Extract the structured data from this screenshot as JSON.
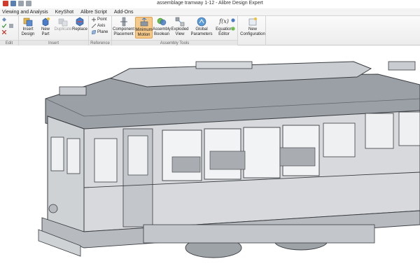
{
  "window": {
    "title": "assemblage tramway 1-12 - Alibre Design Expert"
  },
  "menu": {
    "tabs": [
      {
        "label": "Viewing and Analysis"
      },
      {
        "label": "KeyShot"
      },
      {
        "label": "Alibre Script"
      },
      {
        "label": "Add-Ons"
      }
    ]
  },
  "ribbon": {
    "groups": {
      "edit": "Edit",
      "insert": "Insert",
      "reference": "Reference",
      "assembly_tools": "Assembly Tools"
    },
    "buttons": {
      "insert_design": "Insert Design",
      "new_part": "New Part",
      "duplicate": "Duplicate",
      "replace": "Replace",
      "point": "Point",
      "axis": "Axis",
      "plane": "Plane",
      "component_placement": "Component Placement",
      "minimum_motion": "Minimum Motion",
      "assembly_boolean": "Assembly Boolean",
      "exploded_view": "Exploded View",
      "global_parameters": "Global Parameters",
      "equation_editor": "Equation Editor",
      "new_configuration": "New Configuration"
    },
    "icon_glyphs": {
      "equation_editor": "f(x)"
    }
  },
  "colors": {
    "model_body": "#d7d9dc",
    "model_shadow": "#aeb2b7",
    "roof": "#8f959b",
    "outline": "#3a3d41",
    "active_button": "#f5c98a",
    "ribbon_bg": "#eeeeee"
  }
}
